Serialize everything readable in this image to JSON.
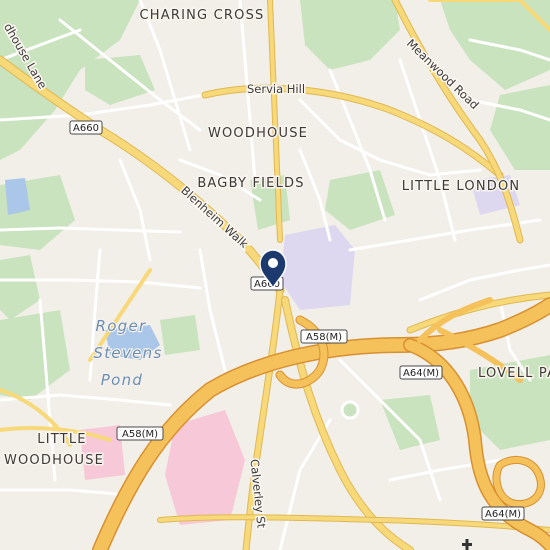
{
  "map": {
    "area_labels": {
      "charing_cross": "CHARING CROSS",
      "woodhouse": "WOODHOUSE",
      "bagby_fields": "BAGBY FIELDS",
      "little_london": "LITTLE LONDON",
      "lovell_park": "LOVELL PA",
      "little_woodhouse_1": "LITTLE",
      "little_woodhouse_2": "WOODHOUSE"
    },
    "street_labels": {
      "servia_hill": "Servia Hill",
      "meanwood_road": "Meanwood Road",
      "woodhouse_lane": "dhouse Lane",
      "blenheim_walk": "Blenheim Walk",
      "calverley_st": "Calverley St"
    },
    "water_labels": {
      "roger_line1": "Roger",
      "roger_line2": "Stevens",
      "roger_line3": "Pond"
    },
    "road_shields": {
      "a660_west": "A660",
      "a660_center": "A660",
      "a58m_center": "A58(M)",
      "a58m_west": "A58(M)",
      "a64m_east": "A64(M)",
      "a64m_southeast": "A64(M)"
    },
    "colors": {
      "background": "#f2efe9",
      "park": "#c8e3bd",
      "motorway": "#f5c15b",
      "primary_road": "#f7d97a",
      "minor_road": "#ffffff",
      "water": "#aac6e8",
      "university": "#ddd7f0",
      "hospital": "#f7c8d8",
      "marker": "#1d3a6e"
    },
    "marker": {
      "icon": "location-pin-icon"
    }
  }
}
